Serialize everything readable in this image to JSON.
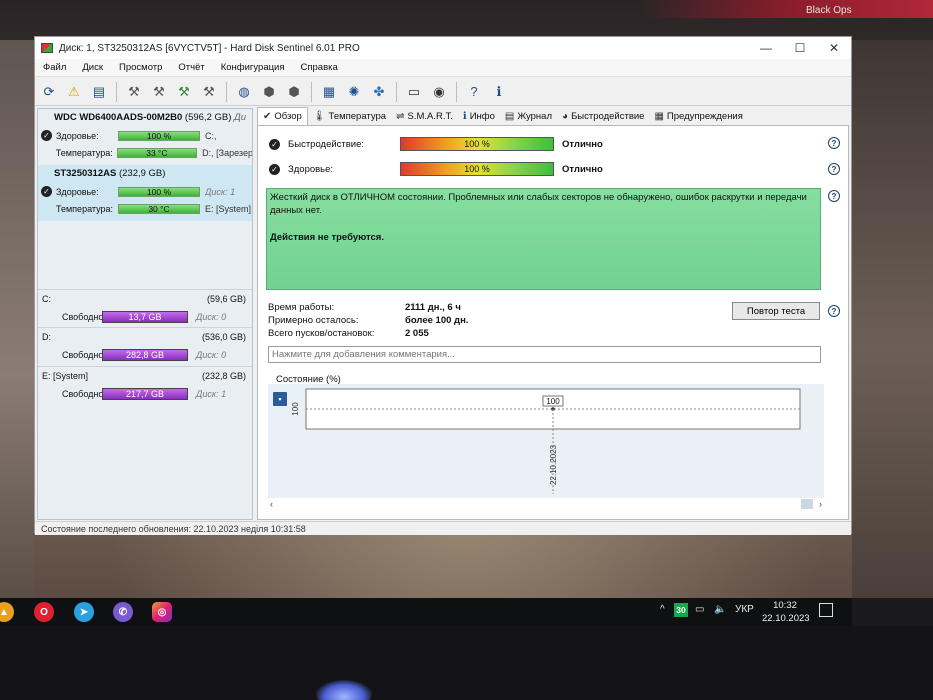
{
  "desktop": {
    "game_label": "Black Ops"
  },
  "window": {
    "title": "Диск: 1, ST3250312AS [6VYCTV5T]  -  Hard Disk Sentinel 6.01 PRO",
    "controls": {
      "minimize": "—",
      "maximize": "☐",
      "close": "✕"
    }
  },
  "menu": [
    "Файл",
    "Диск",
    "Просмотр",
    "Отчёт",
    "Конфигурация",
    "Справка"
  ],
  "toolbar": {
    "icons": [
      "refresh-icon",
      "warning-icon",
      "disk-icon",
      "tools-icon",
      "tools-icon",
      "tools-icon",
      "tools-icon",
      "globe-icon",
      "network-icon",
      "network-icon",
      "document-icon",
      "settings-icon",
      "puzzle-icon",
      "monitor-icon",
      "speaker-icon",
      "help-icon",
      "info-icon"
    ]
  },
  "disks": [
    {
      "name": "WDC WD6400AADS-00M2B0",
      "size": "(596,2 GB)",
      "suffix": "Ди",
      "health_label": "Здоровье:",
      "health": "100 %",
      "health_extra": "C:,",
      "temp_label": "Температура:",
      "temp": "33 °C",
      "temp_extra": "D:, [Зарезер"
    },
    {
      "name": "ST3250312AS",
      "size": "(232,9 GB)",
      "suffix": "",
      "health_label": "Здоровье:",
      "health": "100 %",
      "health_extra": "Диск: 1",
      "temp_label": "Температура:",
      "temp": "30 °C",
      "temp_extra": "E: [System]"
    }
  ],
  "volumes": [
    {
      "name": "C:",
      "size": "(59,6 GB)",
      "free_label": "Свободно",
      "free": "13,7 GB",
      "disk": "Диск: 0"
    },
    {
      "name": "D:",
      "size": "(536,0 GB)",
      "free_label": "Свободно",
      "free": "282,8 GB",
      "disk": "Диск: 0"
    },
    {
      "name": "E: [System]",
      "size": "(232,8 GB)",
      "free_label": "Свободно",
      "free": "217,7 GB",
      "disk": "Диск: 1"
    }
  ],
  "tabs": [
    {
      "label": "Обзор",
      "icon": "check-icon"
    },
    {
      "label": "Температура",
      "icon": "thermometer-icon"
    },
    {
      "label": "S.M.A.R.T.",
      "icon": "smart-icon"
    },
    {
      "label": "Инфо",
      "icon": "info-icon"
    },
    {
      "label": "Журнал",
      "icon": "journal-icon"
    },
    {
      "label": "Быстродействие",
      "icon": "speed-icon"
    },
    {
      "label": "Предупреждения",
      "icon": "warnings-icon"
    }
  ],
  "overview": {
    "performance_label": "Быстродействие:",
    "performance_value": "100 %",
    "performance_rating": "Отлично",
    "health_label": "Здоровье:",
    "health_value": "100 %",
    "health_rating": "Отлично",
    "status_message": "Жесткий диск в ОТЛИЧНОМ состоянии. Проблемных или слабых секторов не обнаружено, ошибок раскрутки и передачи данных нет.",
    "action_message": "Действия не требуются.",
    "uptime_label": "Время работы:",
    "uptime_value": "2111 дн., 6 ч",
    "remaining_label": "Примерно осталось:",
    "remaining_value": "более 100 дн.",
    "starts_label": "Всего пусков/остановок:",
    "starts_value": "2 055",
    "retest_label": "Повтор теста",
    "comment_placeholder": "Нажмите для добавления комментария..."
  },
  "chart_data": {
    "type": "line",
    "title": "Состояние (%)",
    "x": [
      "22.10.2023"
    ],
    "series": [
      {
        "values": [
          100
        ]
      }
    ],
    "ylim": [
      95,
      105
    ],
    "ytick_labels": [
      "100"
    ],
    "data_labels": [
      "100"
    ],
    "grid": true
  },
  "statusbar": {
    "text": "Состояние последнего обновления: 22.10.2023 неділя 10:31:58"
  },
  "taskbar": {
    "apps": [
      "triangle-icon",
      "opera-icon",
      "telegram-icon",
      "viber-icon",
      "instagram-icon"
    ],
    "tray_chevron": "^",
    "tray_badge": "30",
    "language": "УКР",
    "time": "10:32",
    "date": "22.10.2023"
  }
}
